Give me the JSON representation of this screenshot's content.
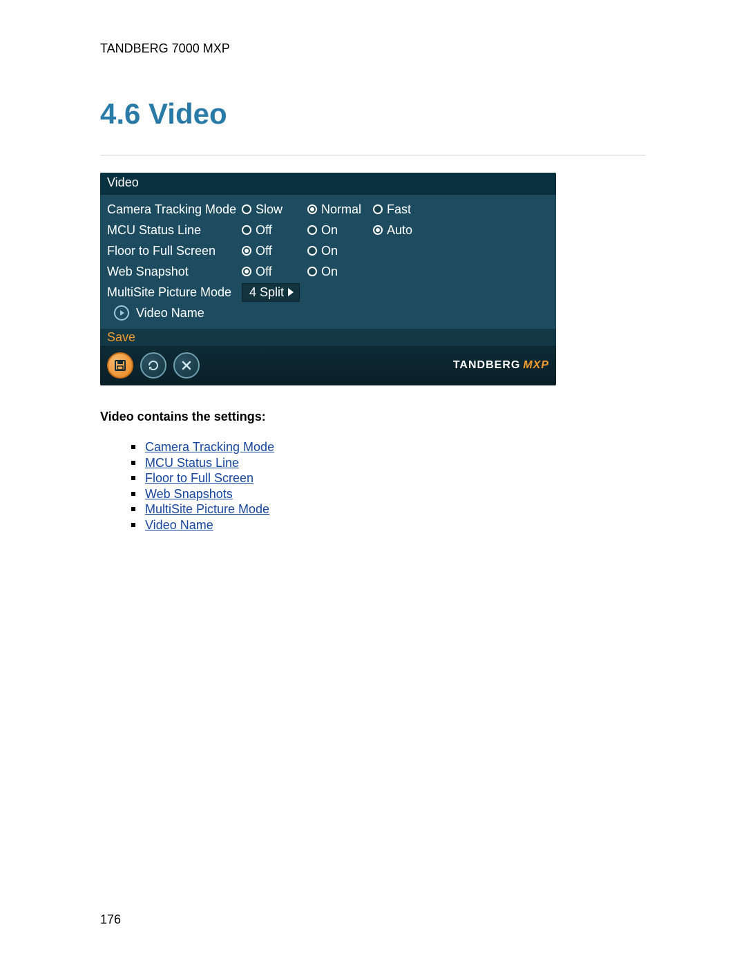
{
  "doc": {
    "header": "TANDBERG 7000 MXP",
    "section_heading": "4.6 Video",
    "settings_header": "Video contains the settings:",
    "page_number": "176"
  },
  "links": [
    "Camera Tracking Mode",
    "MCU Status Line",
    "Floor to Full Screen",
    "Web Snapshots",
    "MultiSite Picture Mode",
    "Video Name"
  ],
  "ui": {
    "title": "Video",
    "rows": {
      "camera_tracking": {
        "label": "Camera Tracking Mode",
        "opts": {
          "slow": "Slow",
          "normal": "Normal",
          "fast": "Fast"
        },
        "selected": "normal"
      },
      "mcu_status": {
        "label": "MCU Status Line",
        "opts": {
          "off": "Off",
          "on": "On",
          "auto": "Auto"
        },
        "selected": "auto"
      },
      "floor_full": {
        "label": "Floor to Full Screen",
        "opts": {
          "off": "Off",
          "on": "On"
        },
        "selected": "off"
      },
      "web_snapshot": {
        "label": "Web Snapshot",
        "opts": {
          "off": "Off",
          "on": "On"
        },
        "selected": "off"
      },
      "multisite": {
        "label": "MultiSite Picture Mode",
        "value": "4 Split"
      },
      "video_name": {
        "label": "Video Name"
      }
    },
    "save_label": "Save",
    "brand": {
      "name": "TANDBERG",
      "suffix": "MXP"
    }
  }
}
